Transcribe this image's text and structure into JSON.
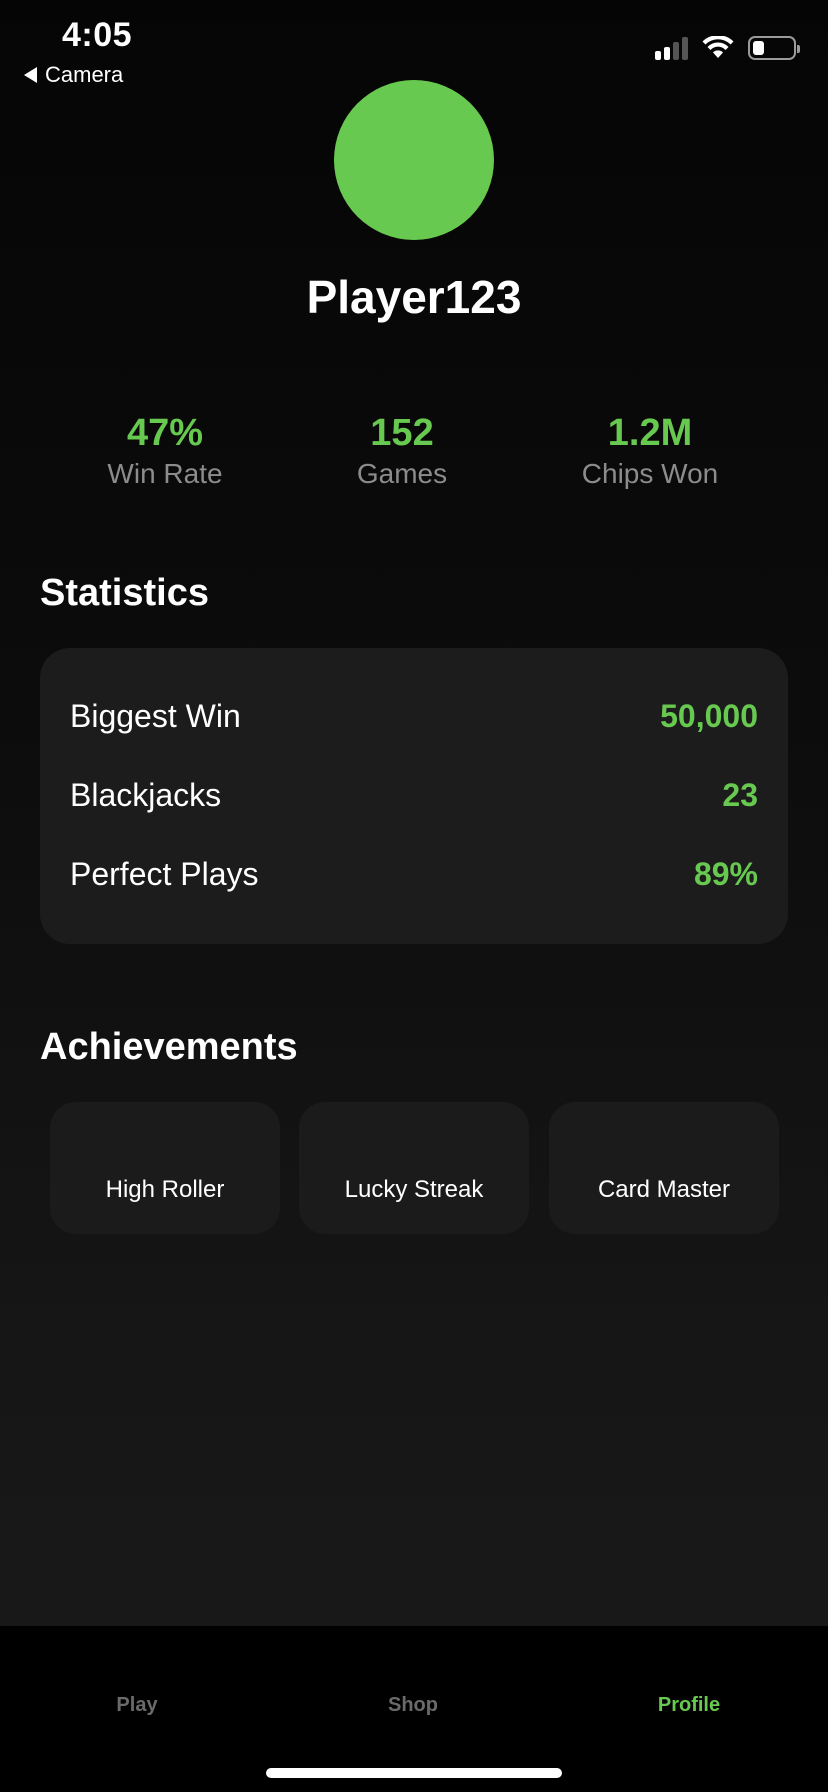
{
  "status_bar": {
    "time": "4:05",
    "back_label": "Camera",
    "battery_level": 0.3
  },
  "profile": {
    "username": "Player123",
    "avatar_color": "#67c94f"
  },
  "quick_stats": [
    {
      "value": "47%",
      "label": "Win Rate"
    },
    {
      "value": "152",
      "label": "Games"
    },
    {
      "value": "1.2M",
      "label": "Chips Won"
    }
  ],
  "statistics": {
    "title": "Statistics",
    "rows": [
      {
        "label": "Biggest Win",
        "value": "50,000"
      },
      {
        "label": "Blackjacks",
        "value": "23"
      },
      {
        "label": "Perfect Plays",
        "value": "89%"
      }
    ]
  },
  "achievements": {
    "title": "Achievements",
    "items": [
      "High Roller",
      "Lucky Streak",
      "Card Master"
    ]
  },
  "tab_bar": {
    "tabs": [
      {
        "label": "Play",
        "active": false
      },
      {
        "label": "Shop",
        "active": false
      },
      {
        "label": "Profile",
        "active": true
      }
    ]
  },
  "colors": {
    "accent": "#67c94f",
    "card_bg": "#1c1c1c",
    "muted_text": "#8c8c8c"
  }
}
